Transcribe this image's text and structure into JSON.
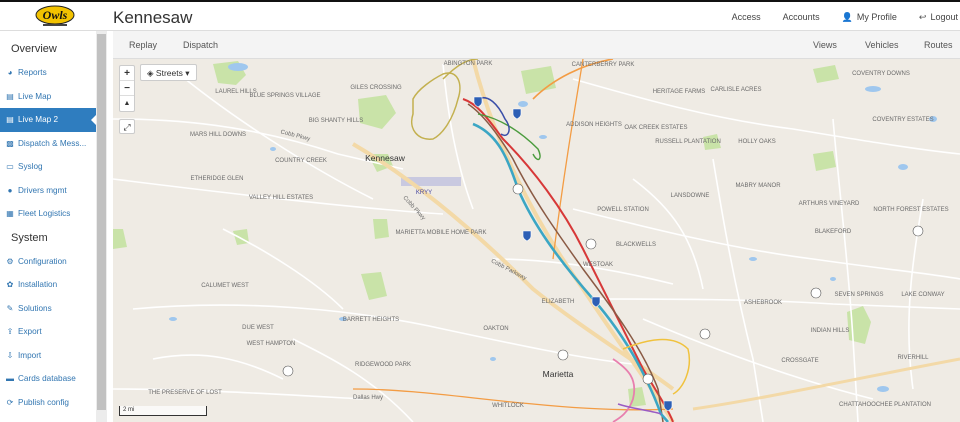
{
  "header": {
    "logo_text": "Owls",
    "title": "Kennesaw",
    "links": [
      {
        "label": "Access",
        "icon": ""
      },
      {
        "label": "Accounts",
        "icon": ""
      },
      {
        "label": "My Profile",
        "icon": "user-icon"
      },
      {
        "label": "Logout",
        "icon": "logout-icon"
      }
    ]
  },
  "sidebar": {
    "section_overview": "Overview",
    "overview_items": [
      {
        "label": "Reports",
        "icon": "pie-chart-icon"
      },
      {
        "label": "Live Map",
        "icon": "map-icon"
      },
      {
        "label": "Live Map 2",
        "icon": "map-icon",
        "active": true
      },
      {
        "label": "Dispatch & Mess...",
        "icon": "bus-icon"
      },
      {
        "label": "Syslog",
        "icon": "terminal-icon"
      },
      {
        "label": "Drivers mgmt",
        "icon": "user-icon"
      },
      {
        "label": "Fleet Logistics",
        "icon": "calendar-icon"
      }
    ],
    "section_system": "System",
    "system_items": [
      {
        "label": "Configuration",
        "icon": "gears-icon"
      },
      {
        "label": "Installation",
        "icon": "wrench-icon"
      },
      {
        "label": "Solutions",
        "icon": "edit-icon"
      },
      {
        "label": "Export",
        "icon": "export-icon"
      },
      {
        "label": "Import",
        "icon": "import-icon"
      },
      {
        "label": "Cards database",
        "icon": "card-icon"
      },
      {
        "label": "Publish config",
        "icon": "publish-icon"
      }
    ]
  },
  "subbar": {
    "replay": "Replay",
    "dispatch": "Dispatch",
    "views": "Views",
    "vehicles": "Vehicles",
    "routes": "Routes"
  },
  "map": {
    "layers_button": "Streets",
    "zoom_in": "+",
    "zoom_out": "−",
    "north": "▲",
    "scale_label": "2 mi",
    "labels": {
      "kennesaw": "Kennesaw",
      "marietta": "Marietta",
      "elizabeth": "ELIZABETH",
      "oakton": "OAKTON",
      "westoak": "WESTOAK",
      "blackwells": "BLACKWELLS",
      "powell_station": "POWELL STATION",
      "lansdowne": "LANSDOWNE",
      "mabry_manor": "MABRY MANOR",
      "holly_oaks": "HOLLY OAKS",
      "russell_plantation": "RUSSELL PLANTATION",
      "oak_creek_estates": "OAK CREEK ESTATES",
      "addison_heights": "ADDISON HEIGHTS",
      "heritage_farms": "HERITAGE FARMS",
      "carlisle_acres": "CARLISLE ACRES",
      "canterberry_park": "CANTERBERRY PARK",
      "coventry_downs": "COVENTRY DOWNS",
      "coventry_estates": "COVENTRY ESTATES",
      "abington_park": "ABINGTON PARK",
      "giles_crossing": "GILES CROSSING",
      "big_shanty_hills": "BIG SHANTY HILLS",
      "blue_springs": "BLUE SPRINGS VILLAGE",
      "laurel_hills": "LAUREL HILLS",
      "mars_hill_downs": "MARS HILL DOWNS",
      "country_creek": "COUNTRY CREEK",
      "etheridge_glen": "ETHERIDGE GLEN",
      "valley_hill_estates": "VALLEY HILL ESTATES",
      "marietta_mobile_home_park": "MARIETTA MOBILE HOME PARK",
      "calumet_west": "CALUMET WEST",
      "due_west": "DUE WEST",
      "west_hampton": "WEST HAMPTON",
      "barrett_heights": "BARRETT HEIGHTS",
      "ridgewood_park": "RIDGEWOOD PARK",
      "the_preserve": "THE PRESERVE OF LOST",
      "whitlock": "WHITLOCK",
      "arthurs_vineyard": "ARTHURS VINEYARD",
      "blakeford": "BLAKEFORD",
      "ashebrook": "ASHEBROOK",
      "seven_springs": "SEVEN SPRINGS",
      "indian_hills": "INDIAN HILLS",
      "crossgate": "CROSSGATE",
      "riverhill": "RIVERHILL",
      "chattahoochee": "CHATTAHOOCHEE PLANTATION",
      "lake_conway": "LAKE CONWAY",
      "north_forest": "NORTH FOREST ESTATES",
      "kryy": "KRYY",
      "cobb_pkwy": "Cobb Pkwy",
      "cobb_parkway": "Cobb Parkway",
      "dallas_hwy": "Dallas Hwy"
    }
  }
}
